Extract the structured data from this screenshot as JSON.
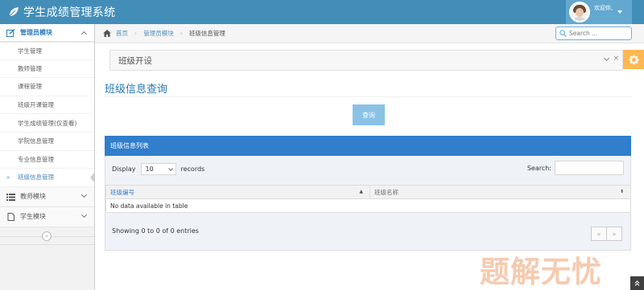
{
  "app": {
    "title": "学生成绩管理系统"
  },
  "user": {
    "welcome": "欢迎你,"
  },
  "sidebar": {
    "groups": [
      {
        "label": "管理员模块",
        "items": [
          {
            "label": "学生管理"
          },
          {
            "label": "教师管理"
          },
          {
            "label": "课程管理"
          },
          {
            "label": "班级开课管理"
          },
          {
            "label": "学生成绩管理(仅查看)"
          },
          {
            "label": "学院信息管理"
          },
          {
            "label": "专业信息管理"
          },
          {
            "label": "班级信息管理"
          }
        ]
      },
      {
        "label": "教师模块"
      },
      {
        "label": "学生模块"
      }
    ],
    "collapse_glyph": "«",
    "current_mark": "»"
  },
  "breadcrumb": {
    "home": "首页",
    "module": "管理员模块",
    "current": "班级信息管理"
  },
  "search": {
    "placeholder": "Search ..."
  },
  "widget": {
    "title": "班级开设"
  },
  "page": {
    "title": "班级信息查询",
    "query_button": "查询"
  },
  "table": {
    "panel_title": "班级信息列表",
    "length_label_before": "Display",
    "length_value": "10",
    "length_label_after": "records",
    "filter_label": "Search:",
    "columns": [
      "班级编号",
      "班级名称"
    ],
    "empty_message": "No data available in table",
    "info": "Showing 0 to 0 of 0 entries",
    "pager": {
      "prev": "«",
      "next": "»"
    }
  },
  "watermark": "题解无忧",
  "colors": {
    "navbar": "#438eb9",
    "panel_header": "#307ecc",
    "accent": "#2679b5",
    "settings": "#ffb752"
  }
}
